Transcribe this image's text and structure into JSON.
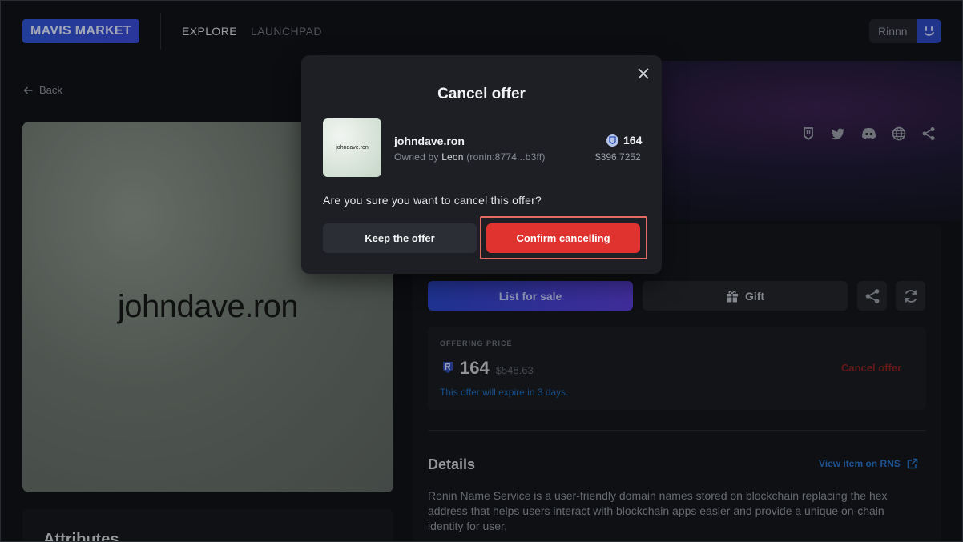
{
  "header": {
    "logo": "MAVIS MARKET",
    "nav": {
      "explore": "EXPLORE",
      "launchpad": "LAUNCHPAD"
    },
    "user": {
      "name": "Rinnn"
    }
  },
  "page": {
    "back_label": "Back",
    "nft_image_text": "johndave.ron",
    "attributes_title": "Attributes",
    "actions": {
      "list_for_sale": "List for sale",
      "gift": "Gift"
    },
    "offer": {
      "label": "OFFERING PRICE",
      "amount": "164",
      "usd": "$548.63",
      "expiry": "This offer will expire in 3 days.",
      "cancel_link": "Cancel offer"
    },
    "details": {
      "title": "Details",
      "rns_link": "View item on RNS",
      "description": "Ronin Name Service is a user-friendly domain names stored on blockchain replacing the hex address that helps users interact with blockchain apps easier and provide a unique on-chain identity for user."
    },
    "social_icons": [
      "ronin-icon",
      "twitter-icon",
      "discord-icon",
      "globe-icon",
      "share-icon"
    ]
  },
  "modal": {
    "title": "Cancel offer",
    "item": {
      "thumb_text": "johndave.ron",
      "name": "johndave.ron",
      "owned_prefix": "Owned by",
      "owner": "Leon",
      "owner_address": "(ronin:8774...b3ff)",
      "price": "164",
      "usd": "$396.7252"
    },
    "question": "Are you sure you want to cancel this offer?",
    "keep_label": "Keep the offer",
    "confirm_label": "Confirm cancelling"
  },
  "colors": {
    "background": "#111318",
    "accent_blue": "#2f55d4",
    "danger_red": "#e0322e",
    "highlight_outline": "#e46b62"
  }
}
